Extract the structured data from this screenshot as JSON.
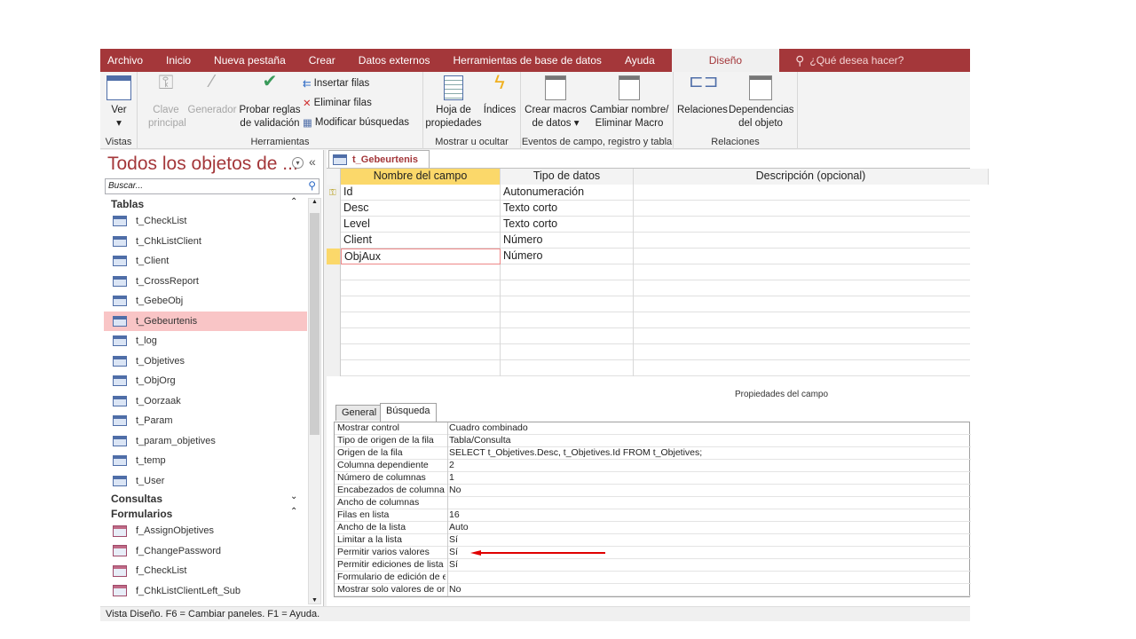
{
  "menu": {
    "items": [
      "Archivo",
      "Inicio",
      "Nueva pestaña",
      "Crear",
      "Datos externos",
      "Herramientas de base de datos",
      "Ayuda"
    ],
    "active": "Diseño",
    "tellme": "¿Qué desea hacer?"
  },
  "ribbon": {
    "vistas": {
      "label": "Vistas",
      "ver": "Ver"
    },
    "herramientas": {
      "label": "Herramientas",
      "clave1": "Clave",
      "clave2": "principal",
      "generador": "Generador",
      "probar1": "Probar reglas",
      "probar2": "de validación",
      "insertar": "Insertar filas",
      "eliminar": "Eliminar filas",
      "modificar": "Modificar búsquedas"
    },
    "mostrar": {
      "label": "Mostrar u ocultar",
      "hoja1": "Hoja de",
      "hoja2": "propiedades",
      "indices": "Índices"
    },
    "eventos": {
      "label": "Eventos de campo, registro y tabla",
      "crear1": "Crear macros",
      "crear2": "de datos",
      "cambiar1": "Cambiar nombre/",
      "cambiar2": "Eliminar Macro"
    },
    "relaciones": {
      "label": "Relaciones",
      "relaciones": "Relaciones",
      "dep1": "Dependencias",
      "dep2": "del objeto"
    }
  },
  "nav": {
    "title": "Todos los objetos de ...",
    "search_placeholder": "Buscar...",
    "tablas_label": "Tablas",
    "tablas": [
      "t_CheckList",
      "t_ChkListClient",
      "t_Client",
      "t_CrossReport",
      "t_GebeObj",
      "t_Gebeurtenis",
      "t_log",
      "t_Objetives",
      "t_ObjOrg",
      "t_Oorzaak",
      "t_Param",
      "t_param_objetives",
      "t_temp",
      "t_User"
    ],
    "selected": "t_Gebeurtenis",
    "consultas_label": "Consultas",
    "formularios_label": "Formularios",
    "formularios": [
      "f_AssignObjetives",
      "f_ChangePassword",
      "f_CheckList",
      "f_ChkListClientLeft_Sub"
    ]
  },
  "doc": {
    "tab": "t_Gebeurtenis",
    "headers": [
      "Nombre del campo",
      "Tipo de datos",
      "Descripción (opcional)"
    ],
    "rows": [
      [
        "Id",
        "Autonumeración"
      ],
      [
        "Desc",
        "Texto corto"
      ],
      [
        "Level",
        "Texto corto"
      ],
      [
        "Client",
        "Número"
      ],
      [
        "ObjAux",
        "Número"
      ]
    ],
    "props_title": "Propiedades del campo",
    "tabs": [
      "General",
      "Búsqueda"
    ],
    "active_tab": "Búsqueda",
    "props": [
      [
        "Mostrar control",
        "Cuadro combinado"
      ],
      [
        "Tipo de origen de la fila",
        "Tabla/Consulta"
      ],
      [
        "Origen de la fila",
        "SELECT t_Objetives.Desc, t_Objetives.Id FROM t_Objetives;"
      ],
      [
        "Columna dependiente",
        "2"
      ],
      [
        "Número de columnas",
        "1"
      ],
      [
        "Encabezados de columna",
        "No"
      ],
      [
        "Ancho de columnas",
        ""
      ],
      [
        "Filas en lista",
        "16"
      ],
      [
        "Ancho de la lista",
        "Auto"
      ],
      [
        "Limitar a la lista",
        "Sí"
      ],
      [
        "Permitir varios valores",
        "Sí"
      ],
      [
        "Permitir ediciones de lista",
        "Sí"
      ],
      [
        "Formulario de edición de elementos de lista",
        ""
      ],
      [
        "Mostrar solo valores de origen de fila",
        "No"
      ]
    ]
  },
  "status": "Vista Diseño.  F6 = Cambiar paneles.  F1 = Ayuda.",
  "colors": {
    "accent": "#a4373a",
    "selected": "#f9c5c6",
    "header": "#fbd86a",
    "annotation_arrow": "#e00000"
  }
}
